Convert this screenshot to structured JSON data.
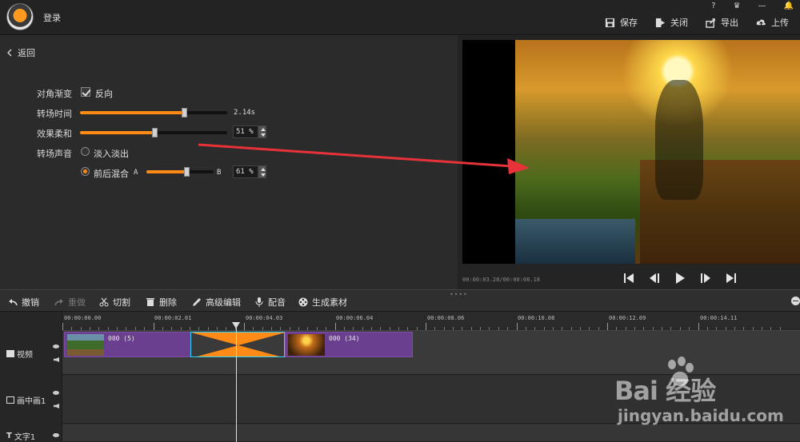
{
  "topbar": {
    "login": "登录",
    "icons": [
      "?",
      "crown-icon",
      "—",
      "bell-icon"
    ],
    "actions": [
      {
        "label": "保存",
        "icon": "save-icon"
      },
      {
        "label": "关闭",
        "icon": "close-icon"
      },
      {
        "label": "导出",
        "icon": "export-icon"
      },
      {
        "label": "上传",
        "icon": "upload-icon"
      }
    ]
  },
  "settings": {
    "back": "返回",
    "diagonal_label": "对角渐变",
    "reverse_label": "反向",
    "reverse_checked": true,
    "duration_label": "转场时间",
    "duration_value": "2.14s",
    "duration_fraction": 0.71,
    "softness_label": "效果柔和",
    "softness_value": "51 %",
    "softness_fraction": 0.51,
    "sound_label": "转场声音",
    "fade_label": "淡入淡出",
    "mix_label": "前后混合",
    "mix_a": "A",
    "mix_b": "B",
    "mix_value": "61 %",
    "mix_fraction": 0.61
  },
  "preview": {
    "timecode": "00:00:03.28/00:00:08.18",
    "transport": [
      "skip-start-icon",
      "step-back-icon",
      "play-icon",
      "step-forward-icon",
      "skip-end-icon"
    ]
  },
  "toolbar": {
    "undo": "撤销",
    "redo": "重做",
    "cut": "切割",
    "delete": "删除",
    "advanced": "高级编辑",
    "dub": "配音",
    "generate": "生成素材"
  },
  "ruler": {
    "ticks": [
      "00:00:00.00",
      "00:00:02.01",
      "00:00:04.03",
      "00:00:06.04",
      "00:00:08.06",
      "00:00:10.08",
      "00:00:12.09",
      "00:00:14.11"
    ]
  },
  "tracks": {
    "video_label": "视频",
    "pip_label": "画中画1",
    "text_label": "文字1",
    "clip1_name": "000 (5)",
    "clip2_name": "000 (34)"
  },
  "watermark": {
    "main": "Bai  经验",
    "url": "jingyan.baidu.com"
  },
  "colors": {
    "accent": "#ff8a16",
    "clip": "#6b3f8f",
    "transition_border": "#2ad6ff",
    "arrow": "#e8323a"
  }
}
